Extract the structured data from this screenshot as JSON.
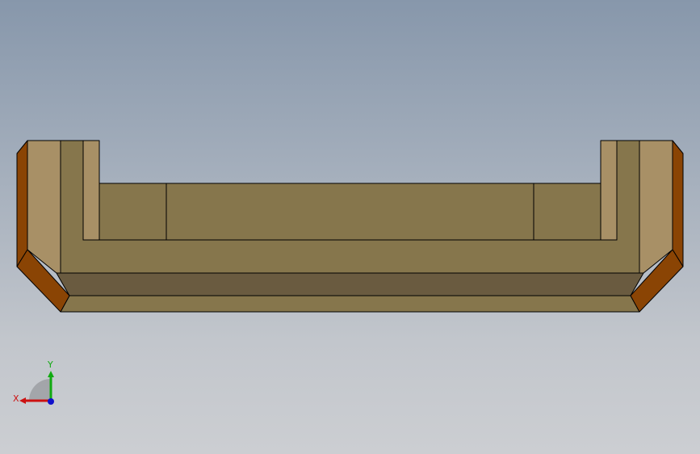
{
  "viewport": {
    "background_top": "#8797ab",
    "background_bottom": "#ccced2"
  },
  "model": {
    "colors": {
      "face_light": "#a89066",
      "face_main": "#86764c",
      "face_mid": "#7d6e48",
      "face_dark": "#6a5b40",
      "chamfer_orange": "#8a4404",
      "underside_light": "#c9b088",
      "edge": "#000000"
    }
  },
  "triad": {
    "x_label": "X",
    "y_label": "Y",
    "x_color": "#cc1111",
    "y_color": "#11aa11",
    "z_color": "#1111cc"
  }
}
